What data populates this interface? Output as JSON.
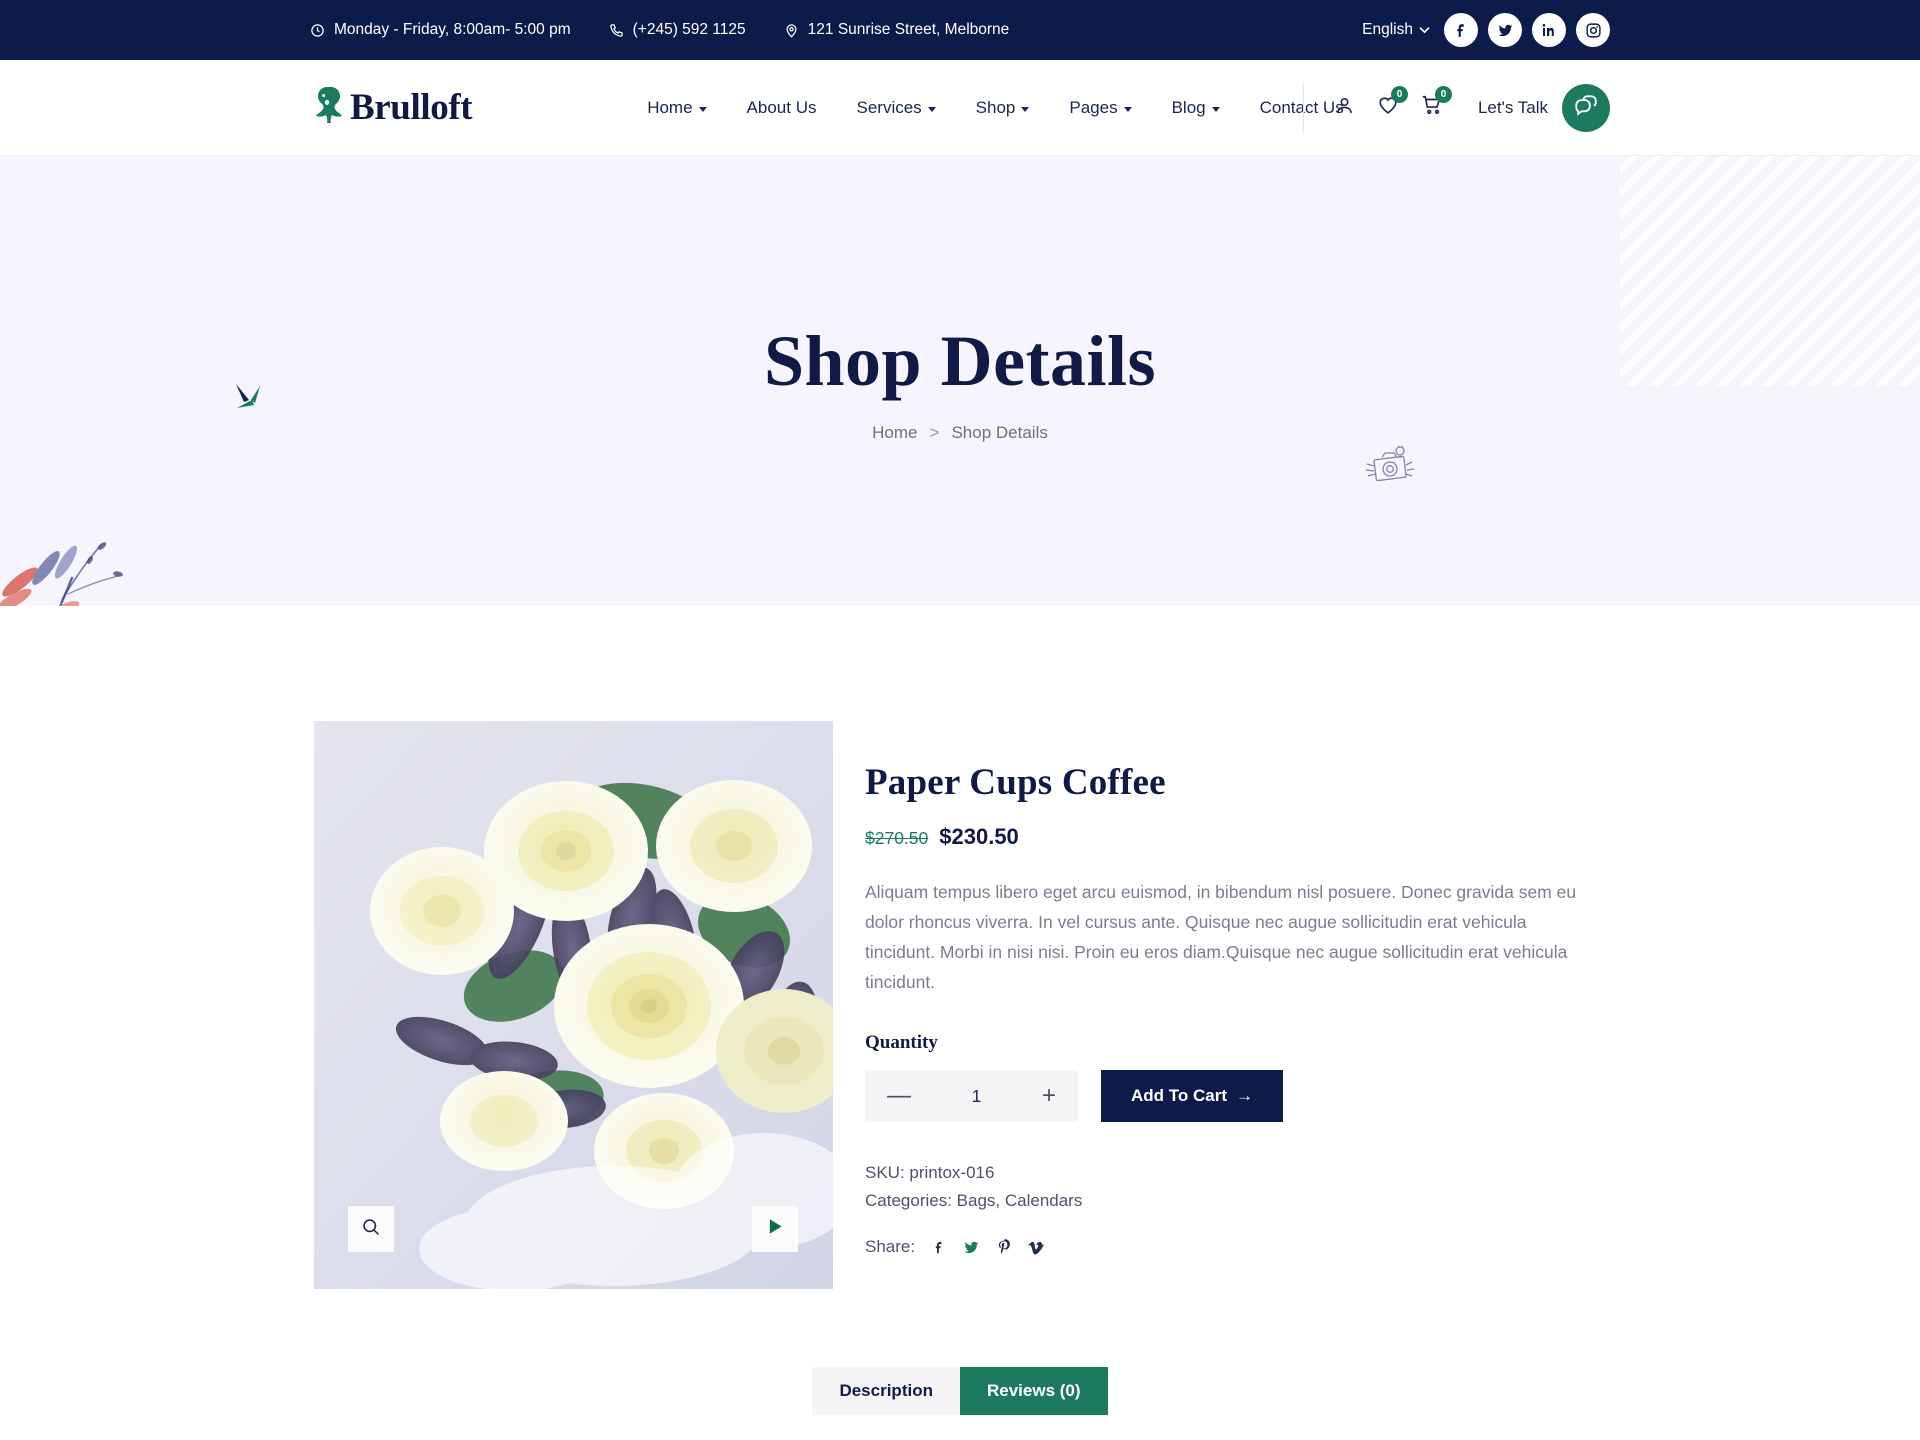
{
  "topbar": {
    "hours": "Monday - Friday, 8:00am- 5:00 pm",
    "phone": "(+245) 592 1125",
    "address": "121 Sunrise Street, Melborne",
    "language": "English",
    "socials": [
      "facebook-icon",
      "twitter-icon",
      "linkedin-icon",
      "instagram-icon"
    ]
  },
  "header": {
    "brand": "Brulloft",
    "nav": [
      {
        "label": "Home",
        "caret": true
      },
      {
        "label": "About Us",
        "caret": false
      },
      {
        "label": "Services",
        "caret": true
      },
      {
        "label": "Shop",
        "caret": true
      },
      {
        "label": "Pages",
        "caret": true
      },
      {
        "label": "Blog",
        "caret": true
      },
      {
        "label": "Contact Us",
        "caret": false
      }
    ],
    "wishlist_count": "0",
    "cart_count": "0",
    "lets_talk": "Let's Talk"
  },
  "hero": {
    "title": "Shop Details",
    "breadcrumb_home": "Home",
    "breadcrumb_sep": ">",
    "breadcrumb_current": "Shop Details"
  },
  "product": {
    "title": "Paper Cups Coffee",
    "old_price": "$270.50",
    "new_price": "$230.50",
    "description": "Aliquam tempus libero eget arcu euismod, in bibendum nisl posuere. Donec gravida sem eu dolor rhoncus viverra. In vel cursus ante. Quisque nec augue sollicitudin erat vehicula tincidunt. Morbi in nisi nisi. Proin eu eros diam.Quisque nec augue sollicitudin erat vehicula tincidunt.",
    "quantity_label": "Quantity",
    "quantity_value": "1",
    "minus": "—",
    "plus": "+",
    "add_to_cart": "Add To Cart",
    "add_to_cart_arrow": "→",
    "sku": "SKU: printox-016",
    "categories": "Categories: Bags, Calendars",
    "share_label": "Share:",
    "share_icons": [
      "facebook-icon",
      "twitter-icon",
      "pinterest-icon",
      "vimeo-icon"
    ],
    "gallery_zoom_icon": "search-icon",
    "gallery_next_icon": "play-icon"
  },
  "tabs": [
    {
      "label": "Description",
      "active": false
    },
    {
      "label": "Reviews (0)",
      "active": true
    }
  ],
  "colors": {
    "navy": "#0d1b4b",
    "green": "#1c7a5e",
    "hero_bg": "#f6f5fd",
    "muted": "#7b7d90"
  }
}
